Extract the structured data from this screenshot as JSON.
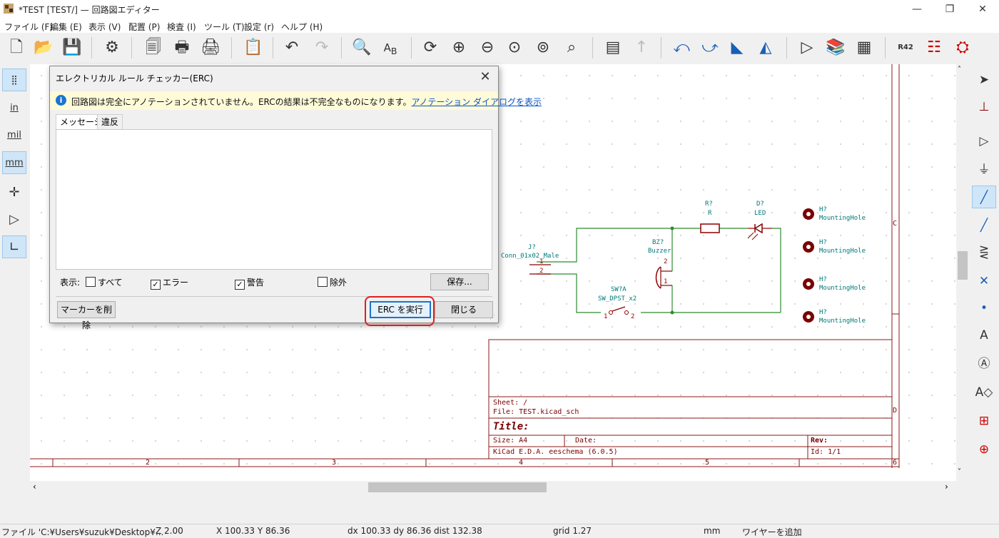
{
  "window": {
    "title": "*TEST [TEST/] — 回路図エディター",
    "minimize": "—",
    "restore": "❐",
    "close": "✕"
  },
  "menu": [
    "ファイル (F)",
    "編集 (E)",
    "表示 (V)",
    "配置 (P)",
    "検査 (I)",
    "ツール (T)",
    "設定 (r)",
    "ヘルプ (H)"
  ],
  "left_toolbar": {
    "in": "in",
    "mil": "mil",
    "mm": "mm"
  },
  "dialog": {
    "title": "エレクトリカル ルール チェッカー(ERC)",
    "close": "✕",
    "banner_text": "回路図は完全にアノテーションされていません。ERCの結果は不完全なものになります。",
    "banner_link": "アノテーション ダイアログを表示",
    "tabs": [
      "メッセージ",
      "違反"
    ],
    "show_label": "表示:",
    "filters": [
      {
        "label": "すべて",
        "checked": false
      },
      {
        "label": "エラー",
        "checked": true
      },
      {
        "label": "警告",
        "checked": true
      },
      {
        "label": "除外",
        "checked": false
      }
    ],
    "save_button": "保存...",
    "clear_markers_button": "マーカーを削除",
    "run_button": "ERC を実行",
    "close_button": "閉じる"
  },
  "schematic": {
    "connector_ref": "J?",
    "connector_value": "Conn_01x02_Male",
    "pin1": "1",
    "pin2": "2",
    "resistor_ref": "R?",
    "resistor_value": "R",
    "led_ref": "D?",
    "led_value": "LED",
    "buzzer_ref": "BZ?",
    "buzzer_value": "Buzzer",
    "bz_pin1": "1",
    "bz_pin2": "2",
    "switch_ref": "SW?A",
    "switch_value": "SW_DPST_x2",
    "sw_pin1": "1",
    "sw_pin2": "2",
    "mounting_holes": [
      {
        "ref": "H?",
        "value": "MountingHole"
      },
      {
        "ref": "H?",
        "value": "MountingHole"
      },
      {
        "ref": "H?",
        "value": "MountingHole"
      },
      {
        "ref": "H?",
        "value": "MountingHole"
      }
    ],
    "title_block": {
      "sheet": "Sheet: /",
      "file": "File: TEST.kicad_sch",
      "title": "Title:",
      "size": "Size: A4",
      "date": "Date:",
      "rev": "Rev:",
      "generator": "KiCad E.D.A.  eeschema (6.0.5)",
      "id": "Id: 1/1"
    },
    "border_columns": [
      "2",
      "3",
      "4",
      "5",
      "6"
    ],
    "border_rows": [
      "C",
      "D"
    ]
  },
  "status": {
    "file": "ファイル 'C:¥Users¥suzuk¥Desktop¥...",
    "zoom": "Z 2.00",
    "xy": "X 100.33  Y 86.36",
    "delta": "dx 100.33  dy 86.36  dist 132.38",
    "grid": "grid 1.27",
    "units": "mm",
    "action": "ワイヤーを追加"
  },
  "colors": {
    "wire": "#2e8b2e",
    "symbol": "#8b0000",
    "text": "#007878",
    "sheet_border": "#8b1a1a",
    "highlight": "#e01e1e"
  }
}
